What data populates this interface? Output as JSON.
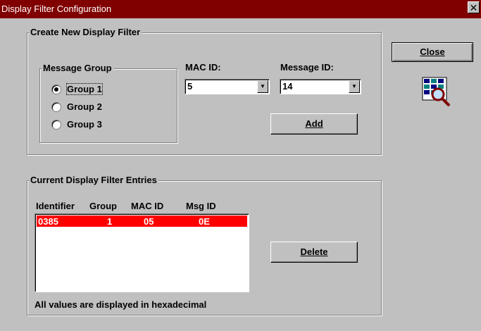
{
  "window": {
    "title": "Display Filter Configuration",
    "close_glyph": "✕"
  },
  "create_group": {
    "title": "Create New Display Filter",
    "message_group": {
      "title": "Message Group",
      "options": [
        "Group 1",
        "Group 2",
        "Group 3"
      ],
      "selected": "Group 1"
    },
    "mac_id": {
      "label": "MAC ID:",
      "value": "5"
    },
    "message_id": {
      "label": "Message ID:",
      "value": "14"
    },
    "add_label": "Add"
  },
  "entries_group": {
    "title": "Current Display Filter Entries",
    "columns": [
      "Identifier",
      "Group",
      "MAC ID",
      "Msg ID"
    ],
    "rows": [
      {
        "identifier": "0385",
        "group": "1",
        "mac_id": "05",
        "msg_id": "0E"
      }
    ],
    "delete_label": "Delete",
    "note": "All values are displayed in hexadecimal"
  },
  "close_label": "Close",
  "icons": {
    "filter": "filter-magnifier-icon"
  },
  "colors": {
    "titlebar": "#800000",
    "selection": "#ff0000",
    "face": "#c0c0c0"
  }
}
